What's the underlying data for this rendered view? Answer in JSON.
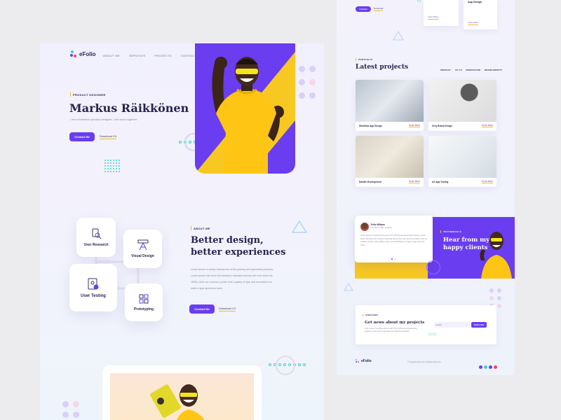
{
  "brand": {
    "name": "eFolio"
  },
  "nav": [
    "ABOUT ME",
    "SERVICES",
    "PROJECTS",
    "CONTACT"
  ],
  "hero": {
    "kicker": "PRODUCT DESIGNER",
    "name": "Markus Räikkönen",
    "tagline": "I am a freelance product designer, Let's work together.",
    "primary_button": "Contact Me",
    "secondary_link": "Download CV"
  },
  "skills": [
    "User Research",
    "Visual Design",
    "User Testing",
    "Prototyping"
  ],
  "about": {
    "kicker": "ABOUT ME",
    "title_line1": "Better design,",
    "title_line2": "better experiences",
    "para": [
      "Lorem Ipsum is simply dummy text of the printing and typesetting industry.",
      "Lorem Ipsum has been the industry's standard dummy text ever since the",
      "1500s, when an unknown printer took a galley of type and scrambled it to",
      "make a type specimen book."
    ],
    "primary_button": "Contact Me",
    "secondary_link": "Download CV"
  },
  "top_right": {
    "button": "Contact",
    "link": "Download",
    "card_link": "Learn More",
    "card_title": "App Design",
    "card_link2": "Learn More"
  },
  "portfolio": {
    "kicker": "PORTFOLIO",
    "title": "Latest projects",
    "tabs": [
      "PRODUCT",
      "UX / UI",
      "INTERACTION",
      "BRAND IDENTITY"
    ],
    "items": [
      {
        "name": "Workflow App Design",
        "link": "Know More"
      },
      {
        "name": "Grey Brand Design",
        "link": "Know More"
      },
      {
        "name": "Dolaffe Development",
        "link": "Know More"
      },
      {
        "name": "UX App Testing",
        "link": "Know More"
      }
    ]
  },
  "testimonial": {
    "kicker": "TESTIMONIALS",
    "title_line1": "Hear from my",
    "title_line2": "happy clients",
    "author": "Felix Wilson",
    "role": "Founder & CEO, LevelUp",
    "quote": "Lorem Ipsum is simply dummy text of the printing and typesetting industry. Lorem Ipsum has been the industry's standard dummy text ever since the 1500s, when an unknown printer took a galley of type and scrambled it to make a type specimen book."
  },
  "newsletter": {
    "kicker": "SUBSCRIBE",
    "title": "Get news about my projects",
    "text": "Lorem Ipsum is simply dummy text of the printing and typesetting industry. Lorem Ipsum has been the industry's standard.",
    "placeholder": "Email",
    "button": "Subscribe"
  },
  "footer": {
    "brand": "eFolio",
    "copyright": "© Copyright 2020 efolio. All Rights Reserved."
  },
  "colors": {
    "accent": "#6a3df0",
    "yellow": "#f8c822",
    "teal": "#3ed1c8",
    "ink": "#28244f"
  }
}
